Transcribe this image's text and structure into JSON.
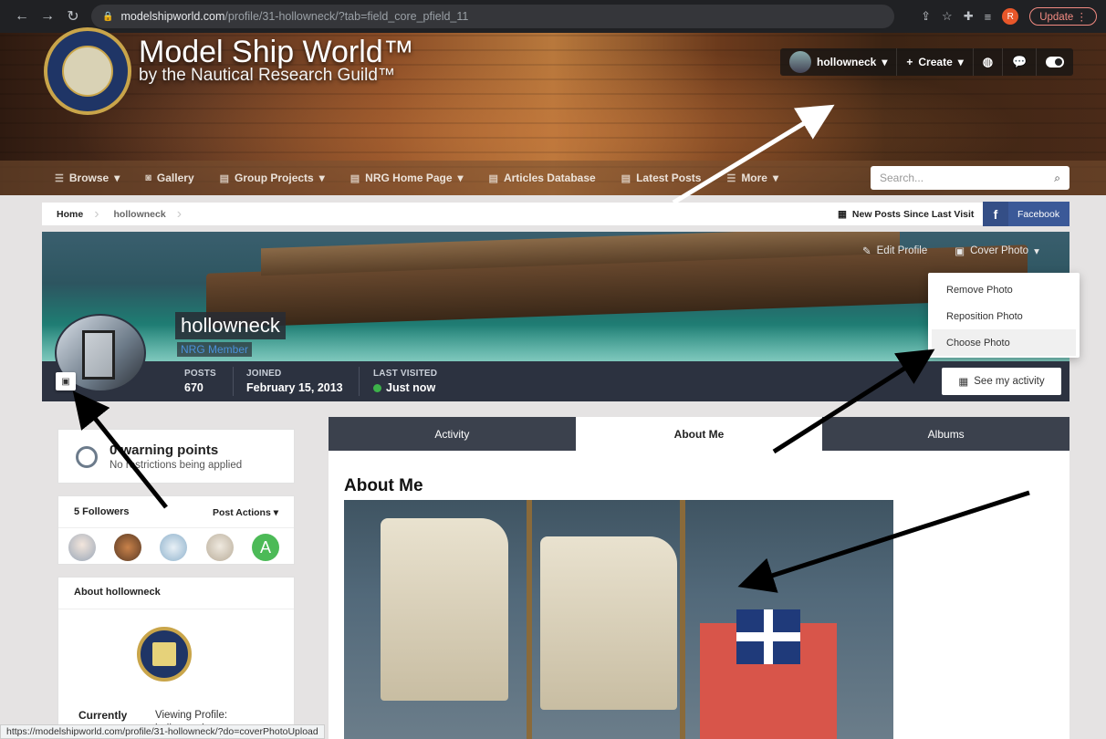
{
  "browser": {
    "url_domain": "modelshipworld.com",
    "url_path": "/profile/31-hollowneck/?tab=field_core_pfield_11",
    "profile_initial": "R",
    "update_label": "Update",
    "status_url": "https://modelshipworld.com/profile/31-hollowneck/?do=coverPhotoUpload"
  },
  "site": {
    "title": "Model Ship World™",
    "subtitle": "by the Nautical Research Guild™"
  },
  "userbar": {
    "username": "hollowneck",
    "create_label": "Create"
  },
  "nav": {
    "items": [
      {
        "label": "Browse",
        "icon": "list-icon",
        "dropdown": true
      },
      {
        "label": "Gallery",
        "icon": "camera-icon",
        "dropdown": false
      },
      {
        "label": "Group Projects",
        "icon": "document-icon",
        "dropdown": true
      },
      {
        "label": "NRG Home Page",
        "icon": "document-icon",
        "dropdown": true
      },
      {
        "label": "Articles Database",
        "icon": "document-icon",
        "dropdown": false
      },
      {
        "label": "Latest Posts",
        "icon": "document-icon",
        "dropdown": false
      },
      {
        "label": "More",
        "icon": "list-icon",
        "dropdown": true
      }
    ],
    "search_placeholder": "Search..."
  },
  "breadcrumb": {
    "home": "Home",
    "current": "hollowneck",
    "new_posts": "New Posts Since Last Visit",
    "facebook": "Facebook"
  },
  "cover": {
    "edit_profile": "Edit Profile",
    "cover_photo": "Cover Photo",
    "menu": [
      "Remove Photo",
      "Reposition Photo",
      "Choose Photo"
    ]
  },
  "profile": {
    "name": "hollowneck",
    "group": "NRG Member",
    "stats": {
      "posts_label": "POSTS",
      "posts_value": "670",
      "joined_label": "JOINED",
      "joined_value": "February 15, 2013",
      "last_label": "LAST VISITED",
      "last_value": "Just now"
    },
    "see_activity": "See my activity"
  },
  "sidebar": {
    "warning_title": "0 warning points",
    "warning_sub": "No restrictions being applied",
    "followers_title": "5 Followers",
    "post_actions": "Post Actions",
    "follower_initial": "A",
    "about_title": "About hollowneck",
    "currently_label": "Currently",
    "currently_value": "Viewing Profile: hollowneck"
  },
  "tabs": [
    "Activity",
    "About Me",
    "Albums"
  ],
  "main": {
    "heading": "About Me"
  },
  "colors": {
    "online": "#3db24a",
    "facebook": "#3b5998",
    "infobar": "#2c3240",
    "tabbar": "#3b414d"
  }
}
